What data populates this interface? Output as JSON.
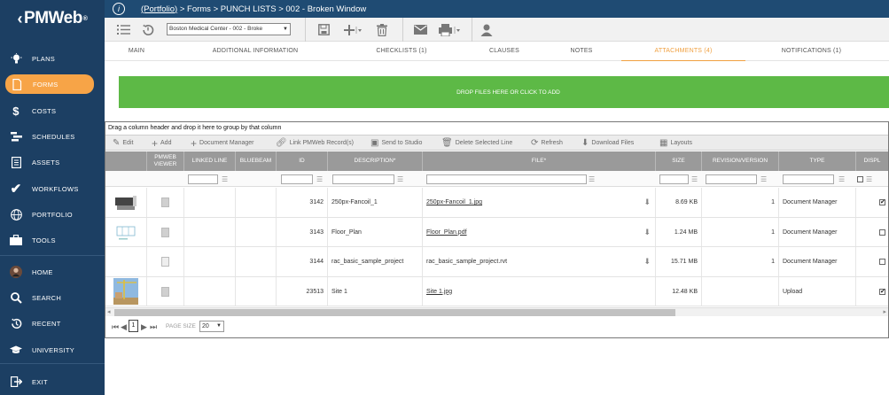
{
  "logo": {
    "text": "PMWeb",
    "mark": "®"
  },
  "sidebar": {
    "items": [
      {
        "label": "PLANS",
        "icon": "lightbulb-icon"
      },
      {
        "label": "FORMS",
        "icon": "document-icon"
      },
      {
        "label": "COSTS",
        "icon": "dollar-icon"
      },
      {
        "label": "SCHEDULES",
        "icon": "schedule-icon"
      },
      {
        "label": "ASSETS",
        "icon": "asset-icon"
      },
      {
        "label": "WORKFLOWS",
        "icon": "checkmark-icon"
      },
      {
        "label": "PORTFOLIO",
        "icon": "globe-icon"
      },
      {
        "label": "TOOLS",
        "icon": "toolbox-icon"
      },
      {
        "label": "HOME",
        "icon": "avatar-icon"
      },
      {
        "label": "SEARCH",
        "icon": "search-icon"
      },
      {
        "label": "RECENT",
        "icon": "history-icon"
      },
      {
        "label": "UNIVERSITY",
        "icon": "graduation-cap-icon"
      },
      {
        "label": "EXIT",
        "icon": "exit-icon"
      }
    ],
    "active": "FORMS",
    "accent": "#f7a447"
  },
  "breadcrumb": {
    "link": "(Portfolio)",
    "rest": " > Forms > PUNCH LISTS > 002 - Broken Window"
  },
  "toolbar": {
    "project": "Boston Medical Center - 002 - Broke"
  },
  "tabs": [
    "MAIN",
    "ADDITIONAL INFORMATION",
    "CHECKLISTS (1)",
    "CLAUSES",
    "NOTES",
    "ATTACHMENTS (4)",
    "NOTIFICATIONS (1)"
  ],
  "active_tab": "ATTACHMENTS (4)",
  "dropzone": "DROP FILES HERE OR CLICK TO ADD",
  "grid": {
    "group_hint": "Drag a column header and drop it here to group by that column",
    "toolbar": [
      "Edit",
      "Add",
      "Document Manager",
      "Link PMWeb Record(s)",
      "Send to Studio",
      "Delete Selected Line",
      "Refresh",
      "Download Files",
      "Layouts"
    ],
    "headers": [
      "PMWEB VIEWER",
      "LINKED LINE",
      "BLUEBEAM",
      "ID",
      "DESCRIPTION*",
      "FILE*",
      "SIZE",
      "REVISION/VERSION",
      "TYPE",
      "DISPL"
    ],
    "rows": [
      {
        "id": "3142",
        "description": "250px-Fancoil_1",
        "file": "250px-Fancoil_1.jpg",
        "size": "8.69 KB",
        "revision": "1",
        "type": "Document Manager",
        "display": true,
        "thumb": "fancoil"
      },
      {
        "id": "3143",
        "description": "Floor_Plan",
        "file": "Floor_Plan.pdf",
        "size": "1.24 MB",
        "revision": "1",
        "type": "Document Manager",
        "display": false,
        "thumb": "plan"
      },
      {
        "id": "3144",
        "description": "rac_basic_sample_project",
        "file": "rac_basic_sample_project.rvt",
        "size": "15.71 MB",
        "revision": "1",
        "type": "Document Manager",
        "display": false,
        "thumb": "none"
      },
      {
        "id": "23513",
        "description": "Site 1",
        "file": "Site 1.jpg",
        "size": "12.48 KB",
        "revision": "",
        "type": "Upload",
        "display": true,
        "thumb": "site"
      }
    ]
  },
  "pager": {
    "page": "1",
    "size_label": "PAGE SIZE",
    "size": "20"
  },
  "colors": {
    "sidebar": "#1c3f63",
    "topbar": "#1f4b73",
    "dropzone": "#5db946",
    "header": "#9a9a9a"
  }
}
